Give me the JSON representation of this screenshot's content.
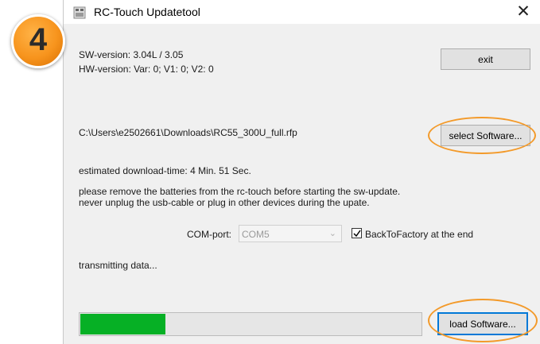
{
  "step_badge": {
    "number": "4",
    "color": "#f7941d"
  },
  "window": {
    "title": "RC-Touch Updatetool",
    "close_label": "✕"
  },
  "info": {
    "sw_version": "SW-version: 3.04L / 3.05",
    "hw_version": "HW-version: Var: 0;  V1: 0;  V2: 0"
  },
  "buttons": {
    "exit": "exit",
    "select_software": "select Software...",
    "load_software": "load Software..."
  },
  "file_path": "C:\\Users\\e2502661\\Downloads\\RC55_300U_full.rfp",
  "download_time": "estimated download-time: 4 Min. 51 Sec.",
  "warnings": {
    "line1": "please remove the batteries from the rc-touch before starting the sw-update.",
    "line2": "never unplug the usb-cable or plug in other devices during the upate."
  },
  "com_port": {
    "label": "COM-port:",
    "value": "COM5"
  },
  "back_to_factory": {
    "label": "BackToFactory at the end",
    "checked": true
  },
  "status": "transmitting data...",
  "progress": {
    "fraction": 0.25,
    "color": "#06b025"
  },
  "highlight_color": "#f39a2a"
}
